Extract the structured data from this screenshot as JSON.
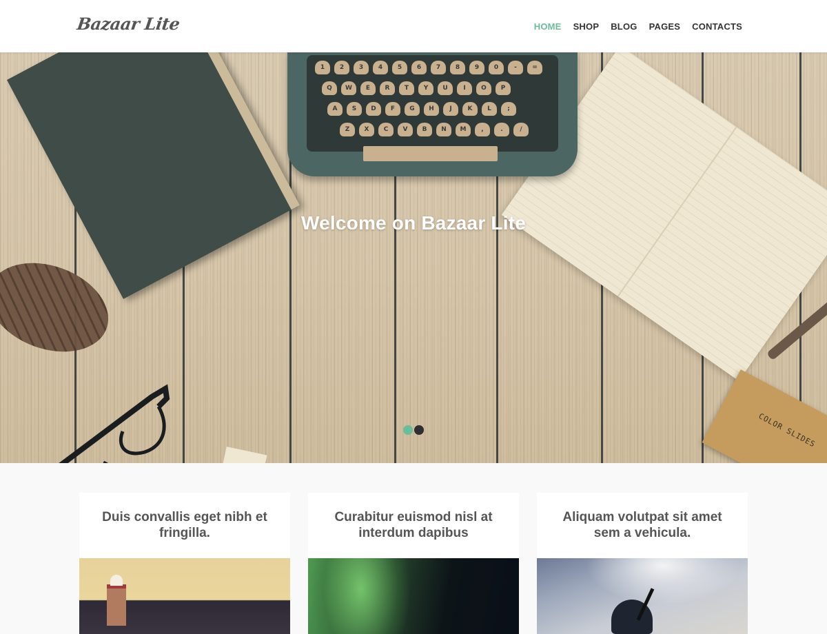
{
  "header": {
    "logo": "Bazaar Lite",
    "nav": [
      {
        "label": "HOME",
        "active": true
      },
      {
        "label": "SHOP",
        "active": false
      },
      {
        "label": "BLOG",
        "active": false
      },
      {
        "label": "PAGES",
        "active": false
      },
      {
        "label": "CONTACTS",
        "active": false
      }
    ]
  },
  "hero": {
    "title": "Welcome on Bazaar Lite",
    "image_description": "wooden desk with typewriter, book, notebook, pinecone, glasses, color slides box",
    "box_label": "COLOR SLIDES",
    "slider": {
      "count": 2,
      "active_index": 0
    }
  },
  "cards": [
    {
      "title": "Duis convallis eget nibh et fringilla.",
      "image": "lighthouse"
    },
    {
      "title": "Curabitur euismod nisl at interdum dapibus",
      "image": "aurora"
    },
    {
      "title": "Aliquam volutpat sit amet sem a vehicula.",
      "image": "airplane"
    }
  ],
  "colors": {
    "accent": "#6bbc9b",
    "nav_text": "#333333",
    "card_title": "#555555",
    "section_bg": "#f9f9f9",
    "dot_inactive": "#2f2f33"
  }
}
